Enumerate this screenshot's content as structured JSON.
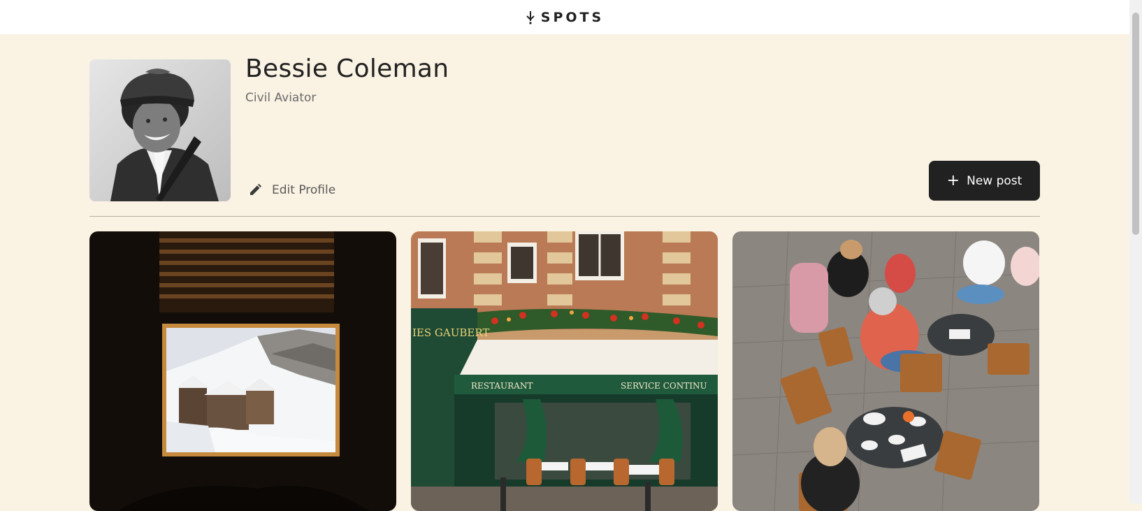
{
  "header": {
    "logo_text": "SPOTS",
    "logo_icon": "spots-logo-icon"
  },
  "profile": {
    "name": "Bessie Coleman",
    "description": "Civil Aviator",
    "edit_label": "Edit Profile",
    "edit_icon": "pencil-icon"
  },
  "actions": {
    "new_post_label": "New post",
    "new_post_icon": "plus-icon"
  },
  "cards": [
    {
      "subject": "window-view-snowy-village"
    },
    {
      "subject": "parisian-restaurant-facade",
      "signs": [
        "IES GAUBERT",
        "RESTAURANT",
        "SERVICE CONTINU"
      ]
    },
    {
      "subject": "outdoor-cafe-tables"
    }
  ],
  "colors": {
    "background": "#FAF2E3",
    "button": "#212121",
    "text": "#212121",
    "muted": "#6b6b6b"
  }
}
